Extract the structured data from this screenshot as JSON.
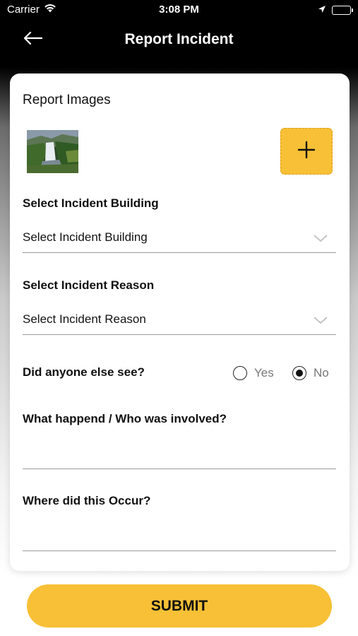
{
  "status_bar": {
    "carrier": "Carrier",
    "time": "3:08 PM"
  },
  "header": {
    "title": "Report Incident"
  },
  "report_images": {
    "title": "Report Images"
  },
  "building": {
    "label": "Select Incident Building",
    "value": "Select Incident Building"
  },
  "reason": {
    "label": "Select Incident Reason",
    "value": "Select Incident Reason"
  },
  "witness": {
    "label": "Did anyone else see?",
    "options": [
      {
        "label": "Yes",
        "checked": false
      },
      {
        "label": "No",
        "checked": true
      }
    ]
  },
  "what_happened": {
    "label": "What happend / Who was involved?",
    "value": ""
  },
  "location": {
    "label": "Where did this Occur?",
    "value": ""
  },
  "submit": {
    "label": "SUBMIT"
  },
  "colors": {
    "accent": "#f7c036",
    "header_bg": "#000000",
    "card_bg": "#ffffff"
  }
}
